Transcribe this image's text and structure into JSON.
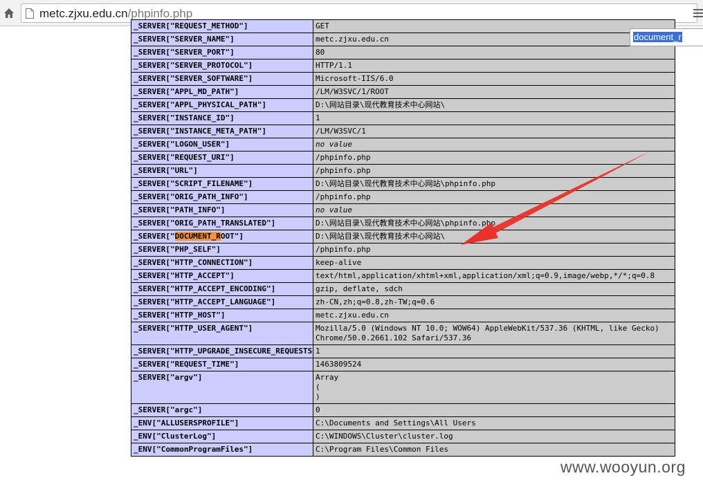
{
  "browser": {
    "url_host": "metc.zjxu.edu.cn",
    "url_path": "/phpinfo.php"
  },
  "find": {
    "query": "document_r"
  },
  "rows": [
    {
      "key": "_SERVER[\"REQUEST_METHOD\"]",
      "value": "GET"
    },
    {
      "key": "_SERVER[\"SERVER_NAME\"]",
      "value": "metc.zjxu.edu.cn"
    },
    {
      "key": "_SERVER[\"SERVER_PORT\"]",
      "value": "80"
    },
    {
      "key": "_SERVER[\"SERVER_PROTOCOL\"]",
      "value": "HTTP/1.1"
    },
    {
      "key": "_SERVER[\"SERVER_SOFTWARE\"]",
      "value": "Microsoft-IIS/6.0"
    },
    {
      "key": "_SERVER[\"APPL_MD_PATH\"]",
      "value": "/LM/W3SVC/1/ROOT"
    },
    {
      "key": "_SERVER[\"APPL_PHYSICAL_PATH\"]",
      "value": "D:\\网站目录\\现代教育技术中心网站\\"
    },
    {
      "key": "_SERVER[\"INSTANCE_ID\"]",
      "value": "1"
    },
    {
      "key": "_SERVER[\"INSTANCE_META_PATH\"]",
      "value": "/LM/W3SVC/1"
    },
    {
      "key": "_SERVER[\"LOGON_USER\"]",
      "value": "no value",
      "novalue": true
    },
    {
      "key": "_SERVER[\"REQUEST_URI\"]",
      "value": "/phpinfo.php"
    },
    {
      "key": "_SERVER[\"URL\"]",
      "value": "/phpinfo.php"
    },
    {
      "key": "_SERVER[\"SCRIPT_FILENAME\"]",
      "value": "D:\\网站目录\\现代教育技术中心网站\\phpinfo.php"
    },
    {
      "key": "_SERVER[\"ORIG_PATH_INFO\"]",
      "value": "/phpinfo.php"
    },
    {
      "key": "_SERVER[\"PATH_INFO\"]",
      "value": "no value",
      "novalue": true
    },
    {
      "key": "_SERVER[\"ORIG_PATH_TRANSLATED\"]",
      "value": "D:\\网站目录\\现代教育技术中心网站\\phpinfo.php"
    },
    {
      "key_prefix": "_SERVER[\"",
      "key_highlight": "DOCUMENT_R",
      "key_suffix": "OOT\"]",
      "value": "D:\\网站目录\\现代教育技术中心网站\\"
    },
    {
      "key": "_SERVER[\"PHP_SELF\"]",
      "value": "/phpinfo.php"
    },
    {
      "key": "_SERVER[\"HTTP_CONNECTION\"]",
      "value": "keep-alive"
    },
    {
      "key": "_SERVER[\"HTTP_ACCEPT\"]",
      "value": "text/html,application/xhtml+xml,application/xml;q=0.9,image/webp,*/*;q=0.8"
    },
    {
      "key": "_SERVER[\"HTTP_ACCEPT_ENCODING\"]",
      "value": "gzip, deflate, sdch"
    },
    {
      "key": "_SERVER[\"HTTP_ACCEPT_LANGUAGE\"]",
      "value": "zh-CN,zh;q=0.8,zh-TW;q=0.6"
    },
    {
      "key": "_SERVER[\"HTTP_HOST\"]",
      "value": "metc.zjxu.edu.cn"
    },
    {
      "key": "_SERVER[\"HTTP_USER_AGENT\"]",
      "value": "Mozilla/5.0 (Windows NT 10.0; WOW64) AppleWebKit/537.36 (KHTML, like Gecko)\nChrome/50.0.2661.102 Safari/537.36"
    },
    {
      "key": "_SERVER[\"HTTP_UPGRADE_INSECURE_REQUESTS\"]",
      "value": "1"
    },
    {
      "key": "_SERVER[\"REQUEST_TIME\"]",
      "value": "1463809524"
    },
    {
      "key": "_SERVER[\"argv\"]",
      "value": "Array\n(\n)"
    },
    {
      "key": "_SERVER[\"argc\"]",
      "value": "0"
    },
    {
      "key": "_ENV[\"ALLUSERSPROFILE\"]",
      "value": "C:\\Documents and Settings\\All Users"
    },
    {
      "key": "_ENV[\"ClusterLog\"]",
      "value": "C:\\WINDOWS\\Cluster\\cluster.log"
    },
    {
      "key": "_ENV[\"CommonProgramFiles\"]",
      "value": "C:\\Program Files\\Common Files"
    }
  ],
  "watermark": "www.wooyun.org",
  "colors": {
    "key_cell": "#ccccff",
    "value_cell": "#cccccc",
    "find_highlight": "#f0933c",
    "arrow": "#e8322a"
  },
  "icons": {
    "home": "home-icon",
    "page": "page-icon",
    "menu": "menu-icon"
  }
}
